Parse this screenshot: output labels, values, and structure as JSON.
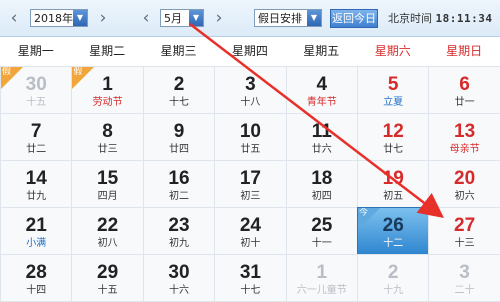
{
  "toolbar": {
    "year_value": "2018年",
    "month_value": "5月",
    "holiday_select": "假日安排",
    "today_button": "返回今日",
    "clock_label": "北京时间",
    "clock_time": "18:11:34",
    "prev_arrow": "‹",
    "next_arrow": "›"
  },
  "weekdays": [
    "星期一",
    "星期二",
    "星期三",
    "星期四",
    "星期五",
    "星期六",
    "星期日"
  ],
  "rows": [
    [
      {
        "num": "30",
        "sub": "十五",
        "style": "other",
        "badge": "假"
      },
      {
        "num": "1",
        "sub": "劳动节",
        "style": "redsub",
        "badge": "假"
      },
      {
        "num": "2",
        "sub": "十七",
        "style": ""
      },
      {
        "num": "3",
        "sub": "十八",
        "style": ""
      },
      {
        "num": "4",
        "sub": "青年节",
        "style": "redsub"
      },
      {
        "num": "5",
        "sub": "立夏",
        "style": "red bluesub"
      },
      {
        "num": "6",
        "sub": "廿一",
        "style": "red"
      }
    ],
    [
      {
        "num": "7",
        "sub": "廿二",
        "style": ""
      },
      {
        "num": "8",
        "sub": "廿三",
        "style": ""
      },
      {
        "num": "9",
        "sub": "廿四",
        "style": ""
      },
      {
        "num": "10",
        "sub": "廿五",
        "style": ""
      },
      {
        "num": "11",
        "sub": "廿六",
        "style": ""
      },
      {
        "num": "12",
        "sub": "廿七",
        "style": "red"
      },
      {
        "num": "13",
        "sub": "母亲节",
        "style": "red redsub"
      }
    ],
    [
      {
        "num": "14",
        "sub": "廿九",
        "style": ""
      },
      {
        "num": "15",
        "sub": "四月",
        "style": ""
      },
      {
        "num": "16",
        "sub": "初二",
        "style": ""
      },
      {
        "num": "17",
        "sub": "初三",
        "style": ""
      },
      {
        "num": "18",
        "sub": "初四",
        "style": ""
      },
      {
        "num": "19",
        "sub": "初五",
        "style": "red"
      },
      {
        "num": "20",
        "sub": "初六",
        "style": "red"
      }
    ],
    [
      {
        "num": "21",
        "sub": "小满",
        "style": "bluesub"
      },
      {
        "num": "22",
        "sub": "初八",
        "style": ""
      },
      {
        "num": "23",
        "sub": "初九",
        "style": ""
      },
      {
        "num": "24",
        "sub": "初十",
        "style": ""
      },
      {
        "num": "25",
        "sub": "十一",
        "style": ""
      },
      {
        "num": "26",
        "sub": "十二",
        "style": "today",
        "badge": "今"
      },
      {
        "num": "27",
        "sub": "十三",
        "style": "red"
      }
    ],
    [
      {
        "num": "28",
        "sub": "十四",
        "style": ""
      },
      {
        "num": "29",
        "sub": "十五",
        "style": ""
      },
      {
        "num": "30",
        "sub": "十六",
        "style": ""
      },
      {
        "num": "31",
        "sub": "十七",
        "style": ""
      },
      {
        "num": "1",
        "sub": "六一儿童节",
        "style": "other"
      },
      {
        "num": "2",
        "sub": "十九",
        "style": "other"
      },
      {
        "num": "3",
        "sub": "二十",
        "style": "other"
      }
    ]
  ],
  "colors": {
    "accent": "#2f66b5",
    "weekend_red": "#d62b2b",
    "annotation_arrow": "#e8302a",
    "holiday_badge": "#f2a53b",
    "today_bg": "#2f86cf"
  }
}
